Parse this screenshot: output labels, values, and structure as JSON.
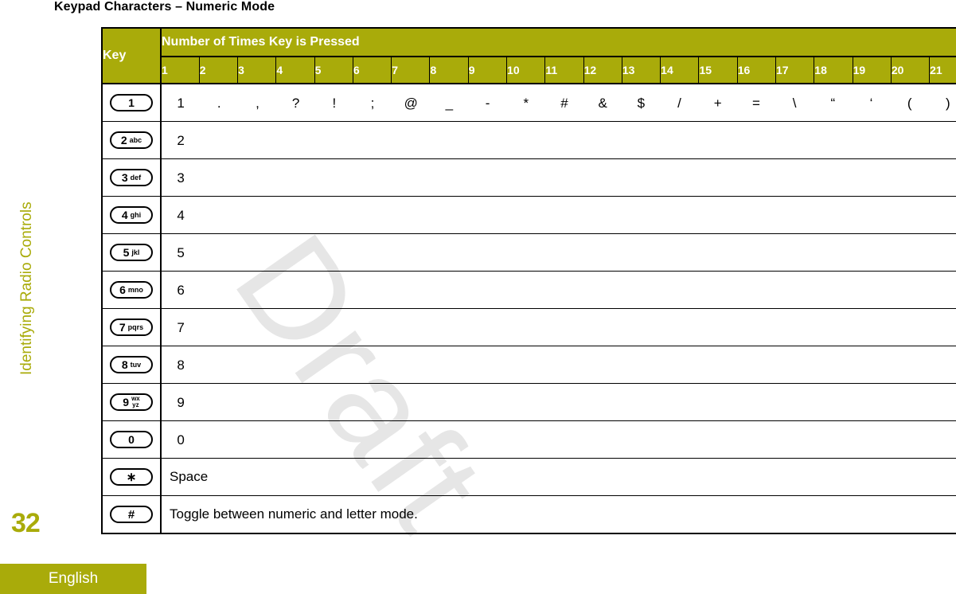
{
  "page": {
    "title": "Keypad Characters – Numeric Mode",
    "chapter": "Identifying Radio Controls",
    "number": "32",
    "language": "English",
    "watermark": "Draft",
    "accent_color": "#a9ab0a"
  },
  "table": {
    "header": {
      "key_label": "Key",
      "span_label": "Number of Times Key is Pressed",
      "press_counts": [
        "1",
        "2",
        "3",
        "4",
        "5",
        "6",
        "7",
        "8",
        "9",
        "10",
        "11",
        "12",
        "13",
        "14",
        "15",
        "16",
        "17",
        "18",
        "19",
        "20",
        "21"
      ]
    },
    "rows": [
      {
        "key": {
          "digit": "1",
          "letters": "",
          "symbol": "",
          "name": "key-1"
        },
        "type": "chars",
        "chars": [
          "1",
          ".",
          ",",
          "?",
          "!",
          ";",
          "@",
          "_",
          "-",
          "*",
          "#",
          "&",
          "$",
          "/",
          "+",
          "=",
          "\\",
          "“",
          "‘",
          "(",
          ")"
        ]
      },
      {
        "key": {
          "digit": "2",
          "letters": "abc",
          "symbol": "",
          "name": "key-2"
        },
        "type": "chars",
        "chars": [
          "2",
          "",
          "",
          "",
          "",
          "",
          "",
          "",
          "",
          "",
          "",
          "",
          "",
          "",
          "",
          "",
          "",
          "",
          "",
          "",
          ""
        ]
      },
      {
        "key": {
          "digit": "3",
          "letters": "def",
          "symbol": "",
          "name": "key-3"
        },
        "type": "chars",
        "chars": [
          "3",
          "",
          "",
          "",
          "",
          "",
          "",
          "",
          "",
          "",
          "",
          "",
          "",
          "",
          "",
          "",
          "",
          "",
          "",
          "",
          ""
        ]
      },
      {
        "key": {
          "digit": "4",
          "letters": "ghi",
          "symbol": "",
          "name": "key-4"
        },
        "type": "chars",
        "chars": [
          "4",
          "",
          "",
          "",
          "",
          "",
          "",
          "",
          "",
          "",
          "",
          "",
          "",
          "",
          "",
          "",
          "",
          "",
          "",
          "",
          ""
        ]
      },
      {
        "key": {
          "digit": "5",
          "letters": "jkl",
          "symbol": "",
          "name": "key-5"
        },
        "type": "chars",
        "chars": [
          "5",
          "",
          "",
          "",
          "",
          "",
          "",
          "",
          "",
          "",
          "",
          "",
          "",
          "",
          "",
          "",
          "",
          "",
          "",
          "",
          ""
        ]
      },
      {
        "key": {
          "digit": "6",
          "letters": "mno",
          "symbol": "",
          "name": "key-6"
        },
        "type": "chars",
        "chars": [
          "6",
          "",
          "",
          "",
          "",
          "",
          "",
          "",
          "",
          "",
          "",
          "",
          "",
          "",
          "",
          "",
          "",
          "",
          "",
          "",
          ""
        ]
      },
      {
        "key": {
          "digit": "7",
          "letters": "pqrs",
          "symbol": "",
          "name": "key-7"
        },
        "type": "chars",
        "chars": [
          "7",
          "",
          "",
          "",
          "",
          "",
          "",
          "",
          "",
          "",
          "",
          "",
          "",
          "",
          "",
          "",
          "",
          "",
          "",
          "",
          ""
        ]
      },
      {
        "key": {
          "digit": "8",
          "letters": "tuv",
          "symbol": "",
          "name": "key-8"
        },
        "type": "chars",
        "chars": [
          "8",
          "",
          "",
          "",
          "",
          "",
          "",
          "",
          "",
          "",
          "",
          "",
          "",
          "",
          "",
          "",
          "",
          "",
          "",
          "",
          ""
        ]
      },
      {
        "key": {
          "digit": "9",
          "letters": "wx\nyz",
          "symbol": "",
          "name": "key-9",
          "stacked": true
        },
        "type": "chars",
        "chars": [
          "9",
          "",
          "",
          "",
          "",
          "",
          "",
          "",
          "",
          "",
          "",
          "",
          "",
          "",
          "",
          "",
          "",
          "",
          "",
          "",
          ""
        ]
      },
      {
        "key": {
          "digit": "0",
          "letters": "",
          "symbol": "",
          "name": "key-0"
        },
        "type": "chars",
        "chars": [
          "0",
          "",
          "",
          "",
          "",
          "",
          "",
          "",
          "",
          "",
          "",
          "",
          "",
          "",
          "",
          "",
          "",
          "",
          "",
          "",
          ""
        ]
      },
      {
        "key": {
          "digit": "",
          "letters": "",
          "symbol": "∗",
          "name": "key-star"
        },
        "type": "text",
        "text": "Space"
      },
      {
        "key": {
          "digit": "",
          "letters": "",
          "symbol": "#",
          "name": "key-pound"
        },
        "type": "text",
        "text": "Toggle between numeric and letter mode."
      }
    ]
  }
}
